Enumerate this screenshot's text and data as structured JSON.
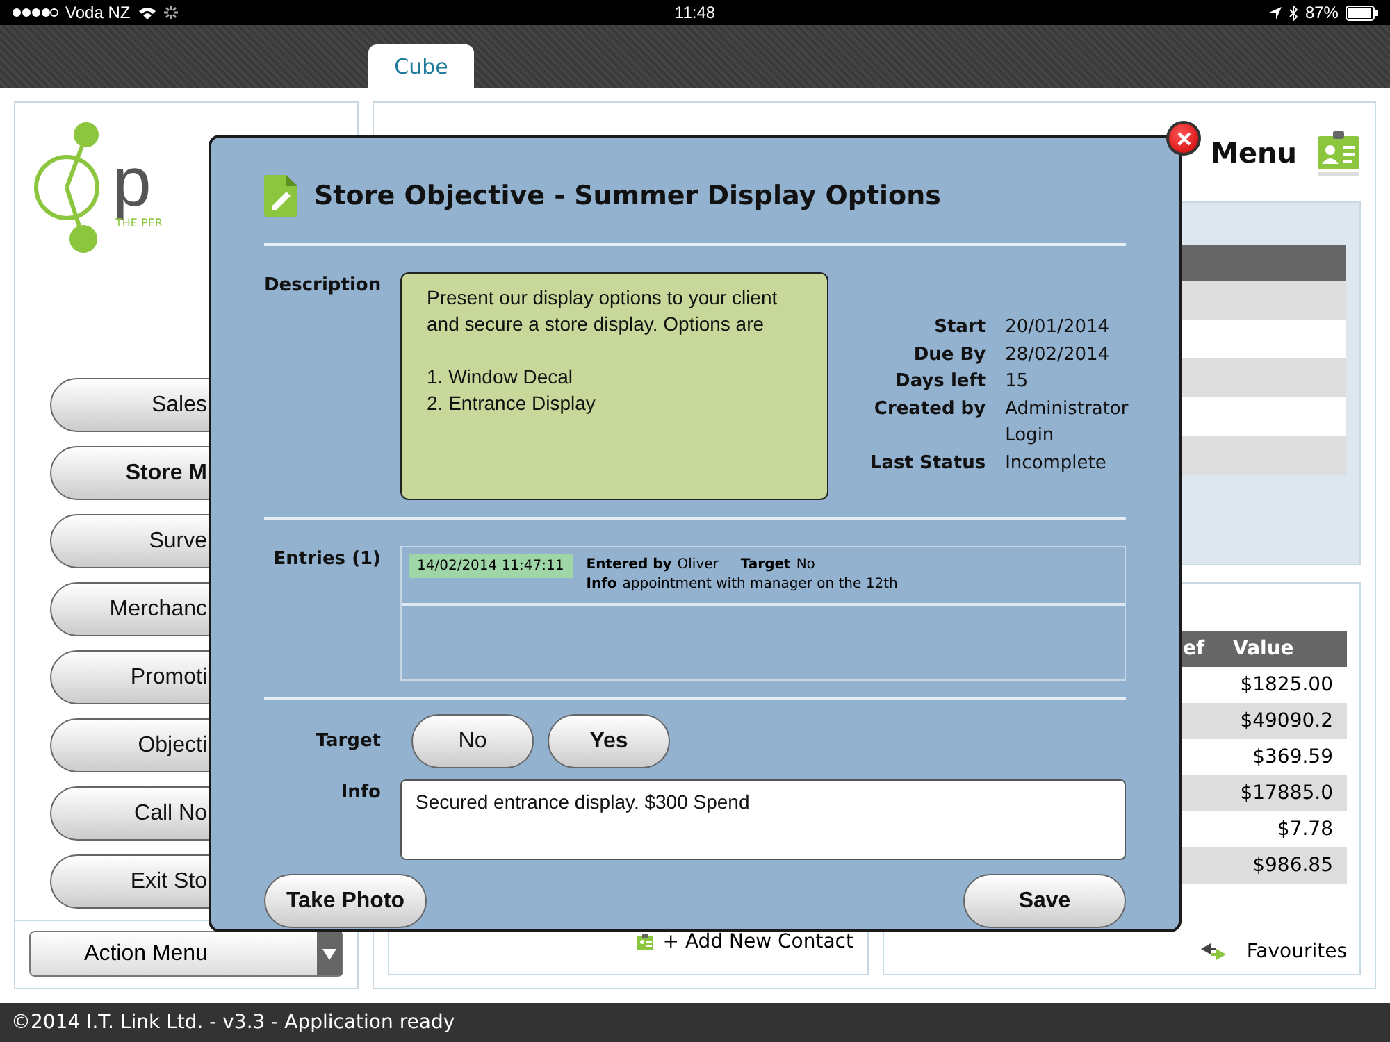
{
  "status_bar": {
    "carrier": "Voda NZ",
    "time": "11:48",
    "battery": "87%"
  },
  "tabs": [
    {
      "label": "Cube",
      "selected": true
    }
  ],
  "logo": {
    "text": "p",
    "tagline": "THE PER"
  },
  "menu_buttons": [
    {
      "label": "Sales",
      "selected": false
    },
    {
      "label": "Store M",
      "selected": true
    },
    {
      "label": "Surve",
      "selected": false
    },
    {
      "label": "Merchanc",
      "selected": false
    },
    {
      "label": "Promoti",
      "selected": false
    },
    {
      "label": "Objecti",
      "selected": false
    },
    {
      "label": "Call No",
      "selected": false
    },
    {
      "label": "Exit Sto",
      "selected": false
    }
  ],
  "action_menu": {
    "label": "Action Menu"
  },
  "header": {
    "title": "Menu"
  },
  "value_table": {
    "columns": [
      "ef",
      "Value"
    ],
    "rows": [
      {
        "value": "$1825.00"
      },
      {
        "value": "$49090.2"
      },
      {
        "value": "$369.59"
      },
      {
        "value": "$17885.0"
      },
      {
        "value": "$7.78"
      },
      {
        "value": "$986.85"
      }
    ]
  },
  "add_contact": "+ Add New Contact",
  "favourites": "Favourites",
  "dialog": {
    "title": "Store Objective - Summer Display Options",
    "description_label": "Description",
    "description": "Present our display options to your client and secure a store display. Options are\n\n1. Window Decal\n2. Entrance Display",
    "details": [
      {
        "label": "Start",
        "value": "20/01/2014"
      },
      {
        "label": "Due By",
        "value": "28/02/2014"
      },
      {
        "label": "Days left",
        "value": "15"
      },
      {
        "label": "Created by",
        "value": "Administrator Login"
      },
      {
        "label": "Last Status",
        "value": "Incomplete"
      }
    ],
    "entries_label": "Entries (1)",
    "entries": [
      {
        "timestamp": "14/02/2014 11:47:11",
        "entered_by_label": "Entered by",
        "entered_by": "Oliver",
        "target_label": "Target",
        "target": "No",
        "info_label": "Info",
        "info": "appointment with manager on the 12th"
      }
    ],
    "target_label": "Target",
    "target_options": [
      {
        "label": "No",
        "selected": false
      },
      {
        "label": "Yes",
        "selected": true
      }
    ],
    "info_label": "Info",
    "info_value": "Secured entrance display. $300 Spend",
    "buttons": [
      "Take Photo",
      "Save"
    ]
  },
  "footer": "©2014 I.T. Link Ltd. - v3.3 - Application ready"
}
